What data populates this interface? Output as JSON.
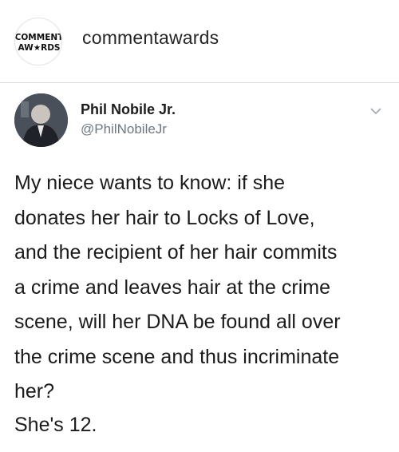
{
  "header": {
    "logo_top": "COMMENT",
    "logo_bottom": "AW★RDS",
    "username": "commentawards"
  },
  "tweet": {
    "display_name": "Phil Nobile Jr.",
    "handle": "@PhilNobileJr",
    "lines": [
      "My niece wants to know: if she",
      "donates her hair to Locks of Love,",
      "and the recipient of her hair commits",
      "a crime and leaves hair at the crime",
      "scene, will her DNA be found all over",
      "the crime scene and thus incriminate",
      "her?"
    ],
    "followup": "She's 12."
  },
  "icons": [
    "comment-awards-logo-icon",
    "profile-photo",
    "chevron-down-icon"
  ]
}
